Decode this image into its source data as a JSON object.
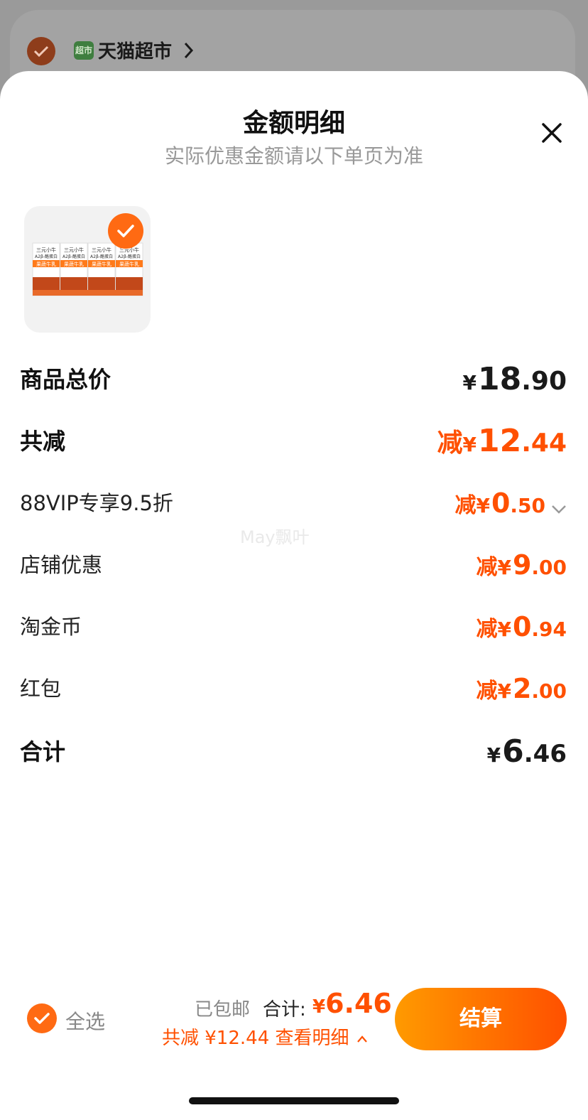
{
  "background": {
    "store_name": "天猫超市",
    "store_logo_text": "超市"
  },
  "sheet": {
    "title": "金额明细",
    "subtitle": "实际优惠金额请以下单页为准"
  },
  "rows": [
    {
      "label": "商品总价",
      "prefix": "",
      "yen": "¥",
      "int": "18",
      "dec": ".90"
    },
    {
      "label": "共减",
      "prefix": "减",
      "yen": "¥",
      "int": "12",
      "dec": ".44"
    },
    {
      "label": "88VIP专享9.5折",
      "prefix": "减",
      "yen": "¥",
      "int": "0",
      "dec": ".50"
    },
    {
      "label": "店铺优惠",
      "prefix": "减",
      "yen": "¥",
      "int": "9",
      "dec": ".00"
    },
    {
      "label": "淘金币",
      "prefix": "减",
      "yen": "¥",
      "int": "0",
      "dec": ".94"
    },
    {
      "label": "红包",
      "prefix": "减",
      "yen": "¥",
      "int": "2",
      "dec": ".00"
    },
    {
      "label": "合计",
      "prefix": "",
      "yen": "¥",
      "int": "6",
      "dec": ".46"
    }
  ],
  "watermark": "May飘叶",
  "product": {
    "box_top": "三元小牛",
    "box_mid": "A2β-酪蛋白",
    "box_flavor": "果蔬牛乳"
  },
  "bottom_bar": {
    "select_all": "全选",
    "shipping": "已包邮",
    "total_label": "合计:",
    "total_yen": "¥",
    "total_value": "6.46",
    "saved_text": "共减 ¥12.44 查看明细",
    "checkout": "结算"
  },
  "colors": {
    "accent": "#ff5000",
    "check": "#ff6a13",
    "gradient_start": "#ff9a00",
    "gradient_end": "#ff5000"
  }
}
